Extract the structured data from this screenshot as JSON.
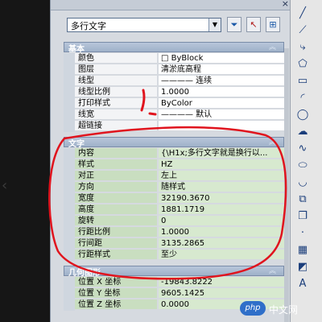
{
  "toolbar": {
    "object_type": "多行文字"
  },
  "sections": {
    "basic": {
      "title": "基本",
      "rows": [
        {
          "label": "颜色",
          "value": "□ ByBlock"
        },
        {
          "label": "图层",
          "value": "清淤底高程"
        },
        {
          "label": "线型",
          "value": "———— 连续"
        },
        {
          "label": "线型比例",
          "value": "1.0000"
        },
        {
          "label": "打印样式",
          "value": "ByColor"
        },
        {
          "label": "线宽",
          "value": "———— 默认"
        },
        {
          "label": "超链接",
          "value": ""
        }
      ]
    },
    "text": {
      "title": "文字",
      "rows": [
        {
          "label": "内容",
          "value": "{\\H1x;多行文字就是换行以..."
        },
        {
          "label": "样式",
          "value": "HZ"
        },
        {
          "label": "对正",
          "value": "左上"
        },
        {
          "label": "方向",
          "value": "随样式"
        },
        {
          "label": "宽度",
          "value": "32190.3670"
        },
        {
          "label": "高度",
          "value": "1881.1719"
        },
        {
          "label": "旋转",
          "value": "0"
        },
        {
          "label": "行距比例",
          "value": "1.0000"
        },
        {
          "label": "行间距",
          "value": "3135.2865"
        },
        {
          "label": "行距样式",
          "value": "至少"
        }
      ]
    },
    "geometry": {
      "title": "几何图形",
      "rows": [
        {
          "label": "位置 X 坐标",
          "value": "-19843.8222"
        },
        {
          "label": "位置 Y 坐标",
          "value": "9605.1425"
        },
        {
          "label": "位置 Z 坐标",
          "value": "0.0000"
        }
      ]
    }
  },
  "colors": {
    "annotation": "#e0141e",
    "section_header": "#a9b9cf",
    "green_row": "#d7e9cf"
  },
  "watermark": {
    "text": "中文网",
    "logo": "php"
  }
}
